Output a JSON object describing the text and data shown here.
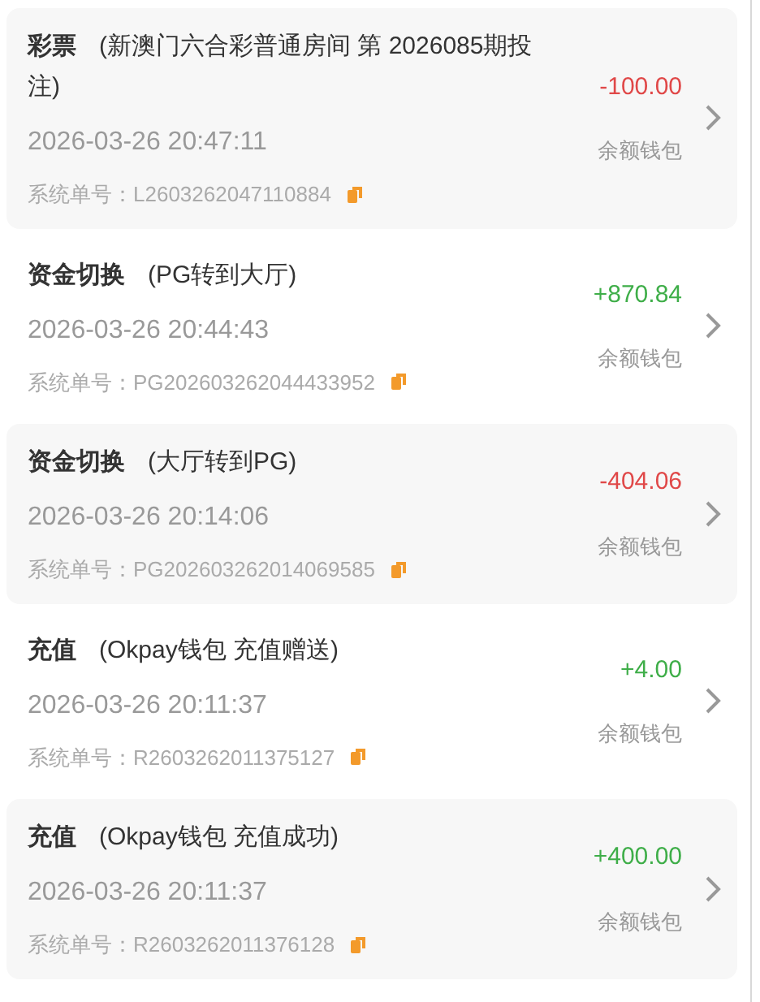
{
  "records": [
    {
      "category": "彩票",
      "detail": "(新澳门六合彩普通房间 第 2026085期投注)",
      "time": "2026-03-26 20:47:11",
      "order_label": "系统单号：",
      "order_no": "L2603262047110884",
      "amount": "-100.00",
      "kind": "debit",
      "wallet": "余额钱包"
    },
    {
      "category": "资金切换",
      "detail": "(PG转到大厅)",
      "time": "2026-03-26 20:44:43",
      "order_label": "系统单号：",
      "order_no": "PG202603262044433952",
      "amount": "+870.84",
      "kind": "credit",
      "wallet": "余额钱包"
    },
    {
      "category": "资金切换",
      "detail": "(大厅转到PG)",
      "time": "2026-03-26 20:14:06",
      "order_label": "系统单号：",
      "order_no": "PG202603262014069585",
      "amount": "-404.06",
      "kind": "debit",
      "wallet": "余额钱包"
    },
    {
      "category": "充值",
      "detail": "(Okpay钱包 充值赠送)",
      "time": "2026-03-26 20:11:37",
      "order_label": "系统单号：",
      "order_no": "R2603262011375127",
      "amount": "+4.00",
      "kind": "credit",
      "wallet": "余额钱包"
    },
    {
      "category": "充值",
      "detail": "(Okpay钱包 充值成功)",
      "time": "2026-03-26 20:11:37",
      "order_label": "系统单号：",
      "order_no": "R2603262011376128",
      "amount": "+400.00",
      "kind": "credit",
      "wallet": "余额钱包"
    }
  ]
}
